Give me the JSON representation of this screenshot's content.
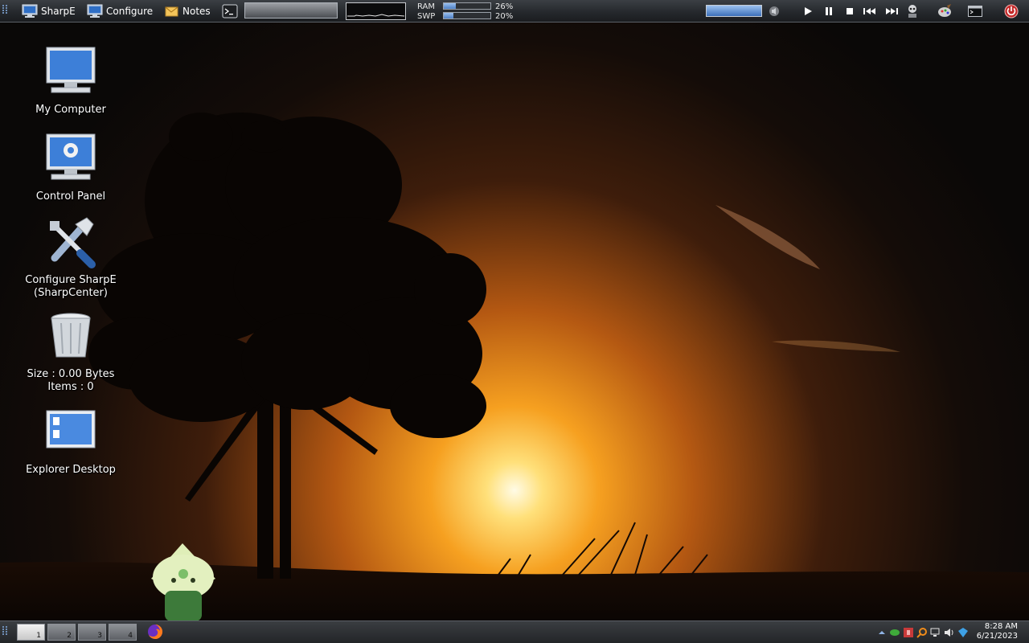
{
  "topbar": {
    "items": [
      {
        "label": "SharpE",
        "icon": "monitor-icon"
      },
      {
        "label": "Configure",
        "icon": "monitor-icon"
      },
      {
        "label": "Notes",
        "icon": "notes-icon"
      }
    ],
    "ram_label": "RAM",
    "swp_label": "SWP",
    "ram_percent": "26%",
    "swp_percent": "20%",
    "ram_value": 0.26,
    "swp_value": 0.2,
    "volume_level": 1.0
  },
  "desktop_icons": [
    {
      "label": "My Computer",
      "icon": "computer-icon"
    },
    {
      "label": "Control Panel",
      "icon": "control-panel-icon"
    },
    {
      "label": "Configure SharpE\n(SharpCenter)",
      "icon": "tools-icon"
    },
    {
      "label": "Size : 0.00 Bytes\nItems : 0",
      "icon": "recycle-bin-icon"
    },
    {
      "label": "Explorer Desktop",
      "icon": "explorer-desktop-icon"
    }
  ],
  "bottombar": {
    "workspaces": [
      "1",
      "2",
      "3",
      "4"
    ],
    "active_workspace": "1",
    "clock_time": "8:28 AM",
    "clock_date": "6/21/2023"
  },
  "colors": {
    "sky_top": "#0d0a08",
    "sun_glow": "#ffb43a",
    "bar_dark": "#24272b",
    "meter_fill": "#4e7fc4"
  }
}
